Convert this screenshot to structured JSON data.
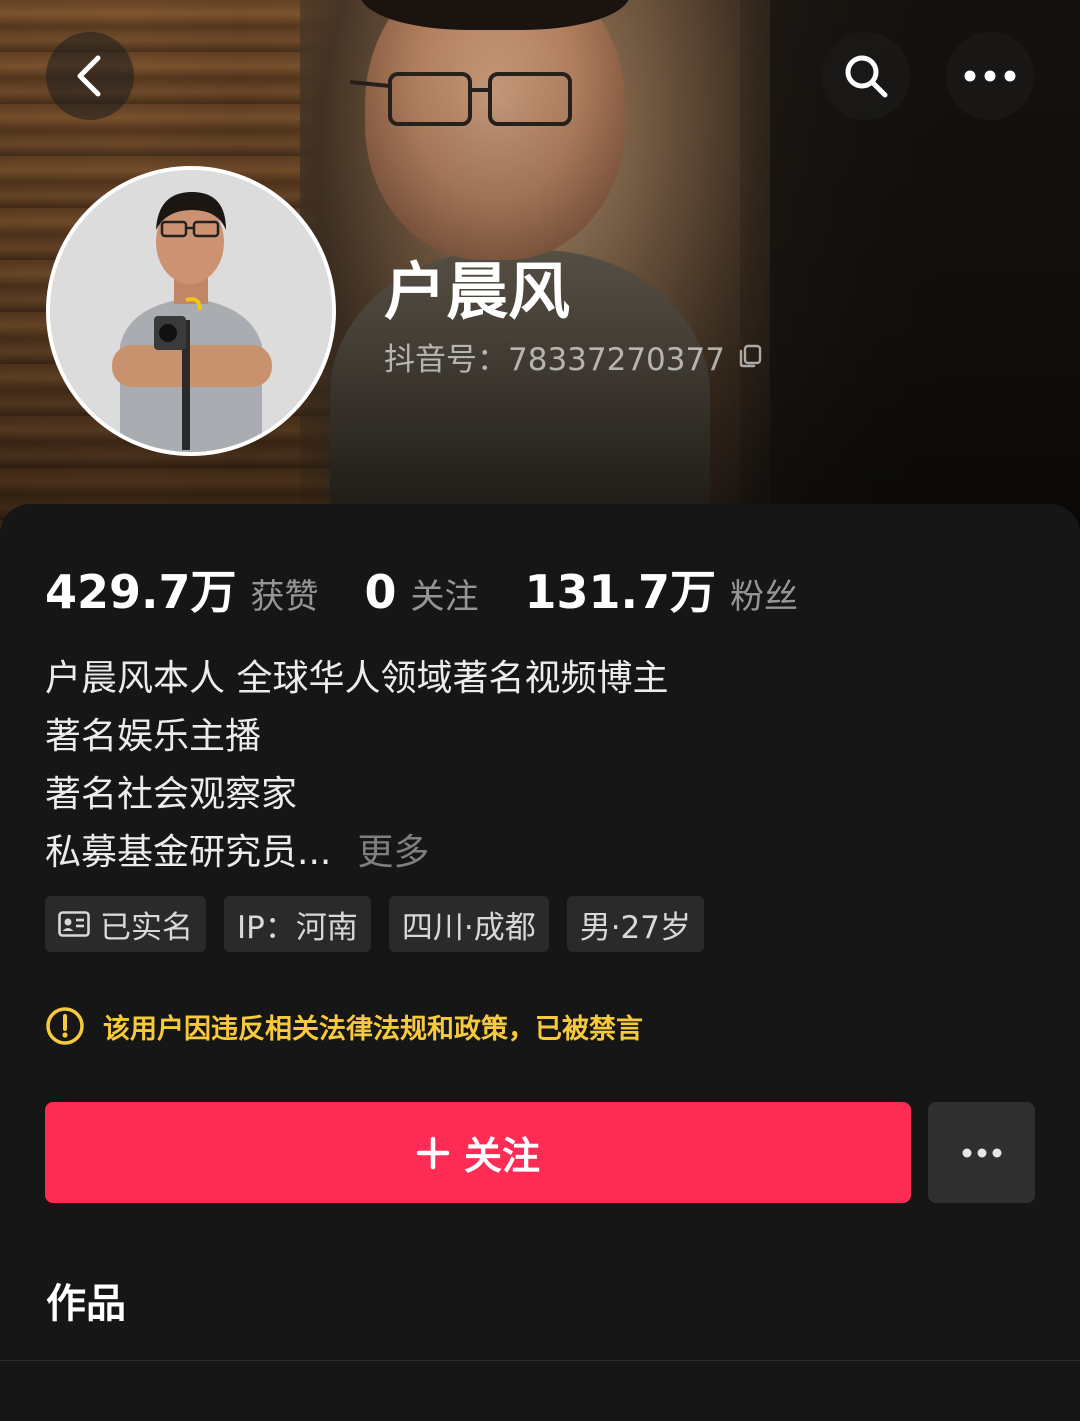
{
  "header": {
    "back_icon": "chevron-left-icon",
    "search_icon": "search-icon",
    "more_icon": "more-horizontal-icon"
  },
  "profile": {
    "name": "户晨风",
    "douyin_id": "抖音号：78337270377",
    "copy_icon": "copy-icon"
  },
  "stats": [
    {
      "value": "429.7万",
      "label": "获赞"
    },
    {
      "value": "0",
      "label": "关注"
    },
    {
      "value": "131.7万",
      "label": "粉丝"
    }
  ],
  "bio": {
    "lines": [
      "户晨风本人  全球华人领域著名视频博主",
      "著名娱乐主播",
      "著名社会观察家",
      "私募基金研究员..."
    ],
    "more_label": "更多"
  },
  "tags": [
    {
      "label": "已实名",
      "icon": "id-card-icon"
    },
    {
      "label": "IP：河南"
    },
    {
      "label": "四川·成都"
    },
    {
      "label": "男·27岁"
    }
  ],
  "notice": {
    "text": "该用户因违反相关法律法规和政策，已被禁言",
    "icon": "warning-icon",
    "color": "#f7c93c"
  },
  "actions": {
    "follow_label": "关注",
    "follow_color": "#fe2c55"
  },
  "tabs": {
    "works_label": "作品"
  }
}
